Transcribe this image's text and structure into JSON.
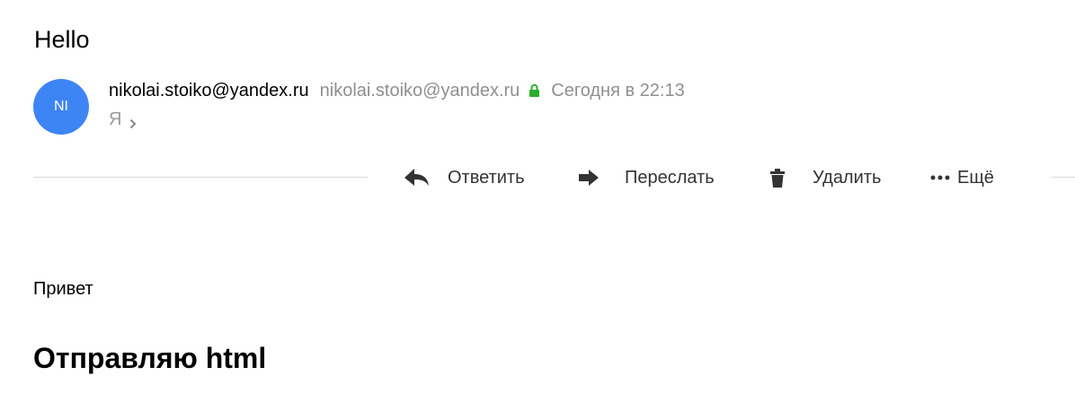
{
  "message": {
    "subject": "Hello",
    "sender": {
      "avatar_initials": "NI",
      "avatar_color": "#3d85f5",
      "name": "nikolai.stoiko@yandex.ru",
      "email": "nikolai.stoiko@yandex.ru",
      "secure_icon": "lock-icon",
      "secure_icon_color": "#2cae2c",
      "date": "Сегодня в 22:13"
    },
    "recipient": {
      "label": "Я",
      "expand_icon": "chevron-right-icon"
    }
  },
  "toolbar": {
    "reply": {
      "label": "Ответить",
      "icon": "reply-icon"
    },
    "forward": {
      "label": "Переслать",
      "icon": "forward-arrow-icon"
    },
    "delete": {
      "label": "Удалить",
      "icon": "trash-icon"
    },
    "more": {
      "label": "Ещё",
      "icon": "more-dots-icon"
    }
  },
  "body": {
    "greeting": "Привет",
    "heading": "Отправляю html"
  }
}
